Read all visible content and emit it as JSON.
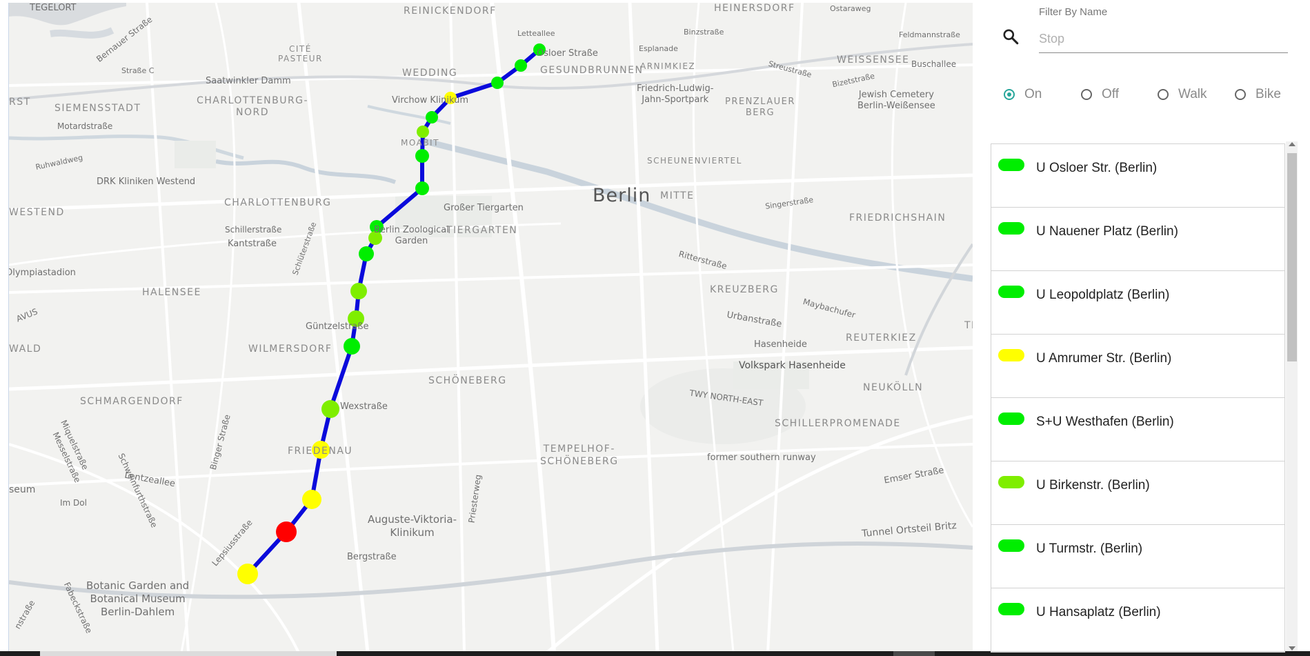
{
  "map": {
    "labels": {
      "tegelort": "TEGELORT",
      "reinickendorf": "REINICKENDORF",
      "heinersdorf": "HEINERSDORF",
      "ostaraweg": "Ostaraweg",
      "letteallee": "Letteallee",
      "osloer": "Osloer Straße",
      "binzstrasse": "Binzstraße",
      "feldmann": "Feldmannstraße",
      "bernauer": "Bernauer Straße",
      "cite_pasteur": "CITÉ\nPASTEUR",
      "wedding": "WEDDING",
      "gesundbrunnen": "GESUNDBRUNNEN",
      "esplanade": "Esplanade",
      "arnimkiez": "ARNIMKIEZ",
      "streustrasse": "Streustraße",
      "weissensee": "WEISSENSEE",
      "buschallee": "Buschallee",
      "strasse_c": "Straße C",
      "saatwinkler": "Saatwinkler Damm",
      "virchow": "Virchow Klinikum",
      "jahn": "Friedrich-Ludwig-\nJahn-Sportpark",
      "prenzlauer": "PRENZLAUER\nBERG",
      "bizetstrasse": "Bizetstraße",
      "jewish": "Jewish Cemetery\nBerlin-Weißensee",
      "rst": "RST",
      "siemensstadt": "SIEMENSSTADT",
      "charl_nord": "CHARLOTTENBURG-\nNORD",
      "motard": "Motardstraße",
      "moabit": "MOABIT",
      "ruhwald": "Ruhwaldweg",
      "scheunenviertel": "SCHEUNENVIERTEL",
      "drk": "DRK Kliniken Westend",
      "westend": "WESTEND",
      "charlottenburg": "CHARLOTTENBURG",
      "tiergarten_gross": "Großer Tiergarten",
      "berlin": "Berlin",
      "mitte": "MITTE",
      "singer": "Singerstraße",
      "friedrichshain": "FRIEDRICHSHAIN",
      "schillerstrasse": "Schillerstraße",
      "zoo": "Berlin Zoological\nGarden",
      "tiergarten": "TIERGARTEN",
      "kantstrasse": "Kantstraße",
      "schlueter": "Schlüterstraße",
      "ritter": "Ritterstraße",
      "stadion": "Olympiastadion",
      "halensee": "HALENSEE",
      "kreuzberg": "KREUZBERG",
      "maybach": "Maybachufer",
      "urban": "Urbanstraße",
      "avus": "AVUS",
      "guentzel": "Güntzelstraße",
      "hasenheide": "Hasenheide",
      "reuterkiez": "REUTERKIEZ",
      "wald": "WALD",
      "wilmersdorf": "WILMERSDORF",
      "volkspark": "Volkspark Hasenheide",
      "schoeneberg": "SCHÖNEBERG",
      "neukoelln": "NEUKÖLLN",
      "schmargendorf": "SCHMARGENDORF",
      "twy": "TWY NORTH-EAST",
      "wexstrasse": "Wexstraße",
      "schillerpromenade": "SCHILLERPROMENADE",
      "miquel": "Miquelstraße",
      "messel": "Messelstraße",
      "binger": "Binger Straße",
      "friedenau": "FRIEDENAU",
      "tempelhof": "TEMPELHOF-\nSCHÖNEBERG",
      "runway": "former southern runway",
      "schweinfurth": "Schweinfurthstraße",
      "lentze": "Lentzeallee",
      "priester": "Priesterweg",
      "emser": "Emser Straße",
      "seum": "seum",
      "imdol": "Im Dol",
      "auguste": "Auguste-Viktoria-\nKlinikum",
      "tunnel": "Tunnel Ortsteil Britz",
      "lepsius": "Lepsiusstraße",
      "bergstrasse": "Bergstraße",
      "botanic": "Botanic Garden and\nBotanical Museum\nBerlin-Dahlem",
      "fabeck": "Fabeckstraße",
      "nstrasse": "nstraße",
      "tf": "TF"
    },
    "route_color": "#0a0adb"
  },
  "filter": {
    "label": "Filter By Name",
    "placeholder": "Stop",
    "value": ""
  },
  "modes": [
    {
      "label": "On",
      "selected": true
    },
    {
      "label": "Off",
      "selected": false
    },
    {
      "label": "Walk",
      "selected": false
    },
    {
      "label": "Bike",
      "selected": false
    }
  ],
  "stops": [
    {
      "name": "U Osloer Str. (Berlin)",
      "color": "#00ee00"
    },
    {
      "name": "U Nauener Platz (Berlin)",
      "color": "#00ee00"
    },
    {
      "name": "U Leopoldplatz (Berlin)",
      "color": "#00ee00"
    },
    {
      "name": "U Amrumer Str. (Berlin)",
      "color": "#ffff00"
    },
    {
      "name": "S+U Westhafen (Berlin)",
      "color": "#00ee00"
    },
    {
      "name": "U Birkenstr. (Berlin)",
      "color": "#7fee00"
    },
    {
      "name": "U Turmstr. (Berlin)",
      "color": "#00ee00"
    },
    {
      "name": "U Hansaplatz (Berlin)",
      "color": "#00ee00"
    }
  ],
  "colors": {
    "green": "#00ee00",
    "lime": "#7fee00",
    "yellow": "#ffff00",
    "red": "#ff0000",
    "accent": "#26a69a"
  }
}
